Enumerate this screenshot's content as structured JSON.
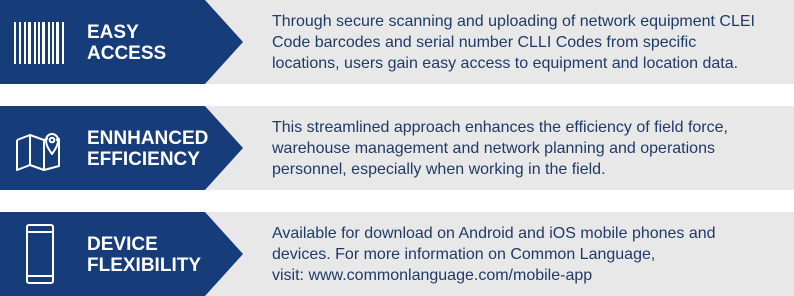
{
  "features": [
    {
      "icon": "barcode-icon",
      "title_line1": "EASY",
      "title_line2": "ACCESS",
      "lines": [
        "Through secure scanning and uploading of network equipment CLEI",
        "Code barcodes and serial number CLLI Codes from specific",
        "locations, users gain easy access to equipment and location data."
      ]
    },
    {
      "icon": "map-pin-icon",
      "title_line1": "ENNHANCED",
      "title_line2": "EFFICIENCY",
      "lines": [
        "This streamlined approach enhances the efficiency of field force,",
        "warehouse management and network planning and operations",
        "personnel, especially when working in the field."
      ]
    },
    {
      "icon": "mobile-phone-icon",
      "title_line1": "DEVICE",
      "title_line2": "FLEXIBILITY",
      "lines": [
        "Available for download on Android and iOS mobile phones and",
        "devices. For more information on Common Language,",
        "visit: www.commonlanguage.com/mobile-app"
      ]
    }
  ],
  "colors": {
    "panel_blue": "#163d7a",
    "panel_gray": "#e8e8e8",
    "text_blue": "#1f3a66"
  }
}
